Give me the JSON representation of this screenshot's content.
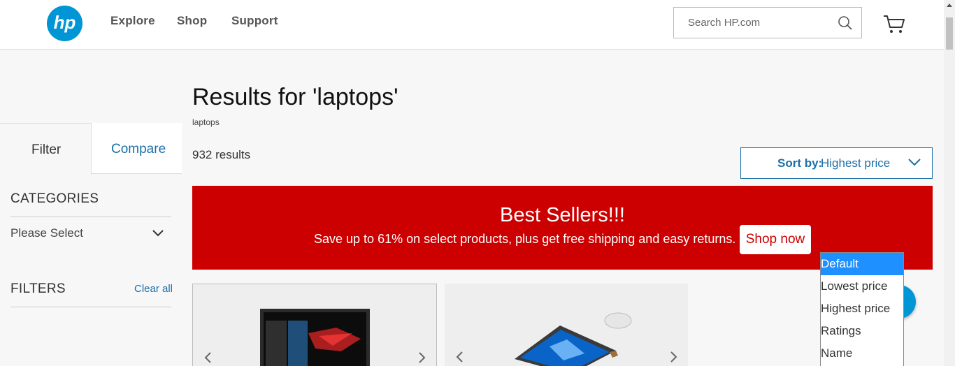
{
  "header": {
    "logo_text": "hp",
    "nav": [
      "Explore",
      "Shop",
      "Support"
    ],
    "search_placeholder": "Search HP.com"
  },
  "sidebar": {
    "tabs": {
      "filter": "Filter",
      "compare": "Compare"
    },
    "categories_heading": "CATEGORIES",
    "categories_select": "Please Select",
    "filters_heading": "FILTERS",
    "clear_all": "Clear all"
  },
  "main": {
    "title": "Results for 'laptops'",
    "subtitle": "laptops",
    "results_count": "932 results",
    "sort": {
      "label": "Sort by:",
      "value": "Highest price"
    },
    "sort_options": [
      "Default",
      "Lowest price",
      "Highest price",
      "Ratings",
      "Name"
    ],
    "sort_highlighted_index": 0
  },
  "banner": {
    "title": "Best Sellers!!!",
    "text": "Save up to 61% on select products, plus get free shipping and easy returns.",
    "button": "Shop now",
    "color": "#cc0000"
  },
  "colors": {
    "brand_blue": "#0096d6",
    "link_blue": "#1a6fa8",
    "highlight": "#1e90ff"
  }
}
